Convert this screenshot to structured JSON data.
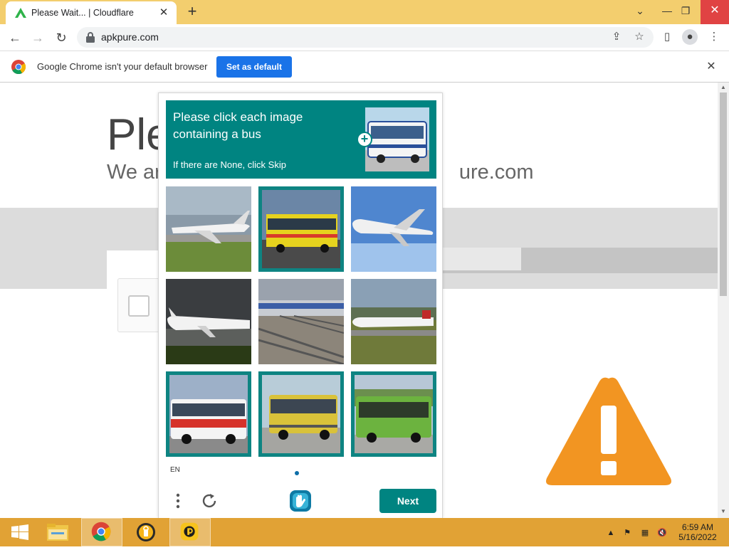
{
  "browser": {
    "tab_title": "Please Wait... | Cloudflare",
    "url": "apkpure.com"
  },
  "infobar": {
    "message": "Google Chrome isn't your default browser",
    "button_label": "Set as default"
  },
  "page": {
    "heading_partial": "Ple",
    "sub_partial_left": "We ar",
    "sub_partial_right": "ure.com"
  },
  "captcha": {
    "prompt": "Please click each image containing a bus",
    "prompt_sub": "If there are None, click Skip",
    "language": "EN",
    "next_label": "Next",
    "accent_color": "#008481",
    "tiles": [
      {
        "subject": "private jet on runway",
        "selected": false
      },
      {
        "subject": "yellow bus",
        "selected": true
      },
      {
        "subject": "airliner in sky",
        "selected": false
      },
      {
        "subject": "jet under dark sky",
        "selected": false
      },
      {
        "subject": "railway tracks",
        "selected": false
      },
      {
        "subject": "airliner landing",
        "selected": false
      },
      {
        "subject": "red and white bus",
        "selected": true
      },
      {
        "subject": "yellow city bus",
        "selected": true
      },
      {
        "subject": "green bus",
        "selected": true
      }
    ]
  },
  "taskbar": {
    "time": "6:59 AM",
    "date": "5/16/2022",
    "apps": [
      "start-icon",
      "file-explorer-icon",
      "chrome-icon",
      "vpn-icon",
      "app-icon"
    ]
  }
}
